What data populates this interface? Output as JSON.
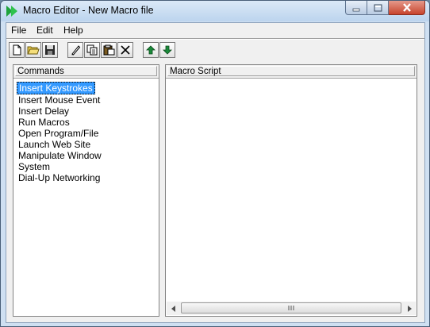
{
  "window": {
    "title": "Macro Editor - New Macro file",
    "icon": "green-arrow-icon"
  },
  "menubar": {
    "items": [
      {
        "label": "File"
      },
      {
        "label": "Edit"
      },
      {
        "label": "Help"
      }
    ]
  },
  "toolbar": {
    "buttons": [
      {
        "icon": "new-file-icon"
      },
      {
        "icon": "open-folder-icon"
      },
      {
        "icon": "save-disk-icon"
      },
      {
        "icon": "edit-pencil-icon"
      },
      {
        "icon": "copy-icon"
      },
      {
        "icon": "paste-icon"
      },
      {
        "icon": "delete-x-icon"
      },
      {
        "icon": "move-up-arrow-icon"
      },
      {
        "icon": "move-down-arrow-icon"
      }
    ]
  },
  "commands_panel": {
    "header": "Commands",
    "items": [
      "Insert Keystrokes",
      "Insert Mouse Event",
      "Insert Delay",
      "Run Macros",
      "Open Program/File",
      "Launch Web Site",
      "Manipulate Window",
      "System",
      "Dial-Up Networking"
    ],
    "selected_index": 0
  },
  "script_panel": {
    "header": "Macro Script"
  },
  "colors": {
    "selection": "#3399ff",
    "accent_arrow": "#1a8a3a",
    "close_button": "#c7442d"
  }
}
